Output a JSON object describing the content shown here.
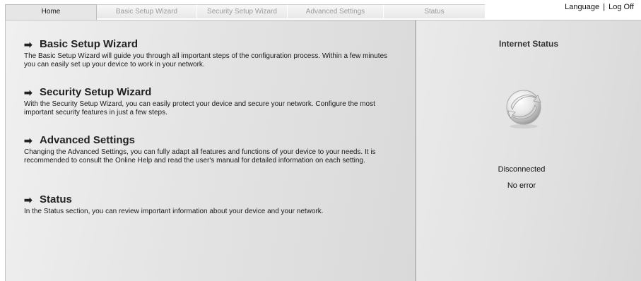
{
  "nav": {
    "tabs": [
      {
        "label": "Home"
      },
      {
        "label": "Basic Setup Wizard"
      },
      {
        "label": "Security Setup Wizard"
      },
      {
        "label": "Advanced Settings"
      },
      {
        "label": "Status"
      }
    ],
    "language_label": "Language",
    "separator": "|",
    "logoff_label": "Log Off"
  },
  "main": {
    "sections": [
      {
        "title": "Basic Setup Wizard",
        "text": "The Basic Setup Wizard will guide you through all important steps of the configuration process. Within a few minutes you can easily set up your device to work in your network."
      },
      {
        "title": "Security Setup Wizard",
        "text": "With the Security Setup Wizard, you can easily protect your device and secure your network. Configure the most important security features in just a few steps."
      },
      {
        "title": "Advanced Settings",
        "text": "Changing the Advanced Settings, you can fully adapt all features and functions of your device to your needs. It is recommended to consult the Online Help and read the user's manual for detailed information on each setting."
      },
      {
        "title": "Status",
        "text": "In the Status section, you can review important information about your device and your network."
      }
    ]
  },
  "side": {
    "title": "Internet Status",
    "icon": "globe-disconnected-icon",
    "connection": "Disconnected",
    "error": "No error"
  }
}
